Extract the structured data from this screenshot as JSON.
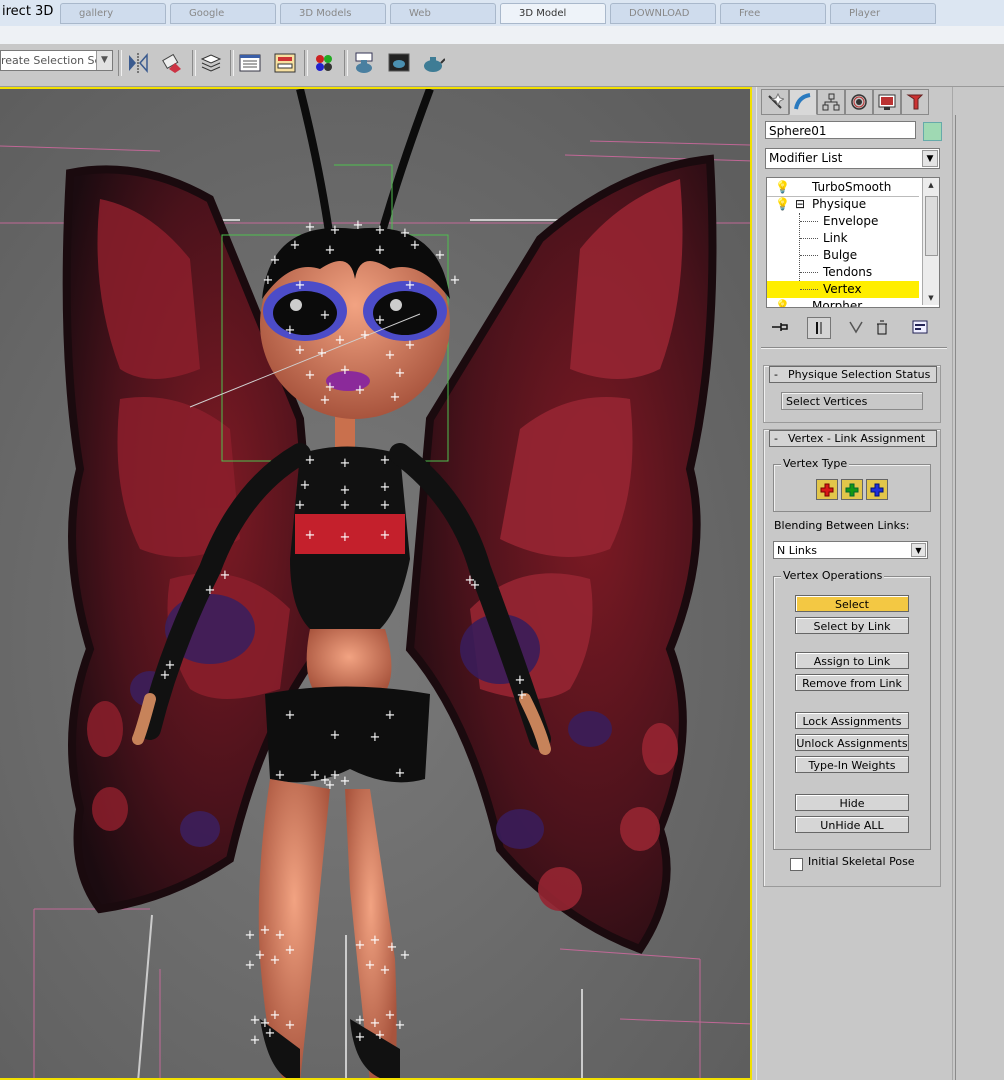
{
  "window": {
    "title": "irect 3D"
  },
  "tabs": [
    {
      "label": "gallery"
    },
    {
      "label": "Google"
    },
    {
      "label": "3D Models"
    },
    {
      "label": "Web"
    },
    {
      "label": "3D Model",
      "active": true
    },
    {
      "label": "DOWNLOAD"
    },
    {
      "label": "Free"
    },
    {
      "label": "Player"
    }
  ],
  "toolbar": {
    "selection_set": {
      "value": "reate Selection Set"
    },
    "icons": [
      "mirror-icon",
      "align-icon",
      "layer-manager-icon",
      "track-view-icon",
      "schematic-view-icon",
      "material-editor-icon",
      "render-setup-icon",
      "rendered-frame-icon",
      "quick-render-icon"
    ]
  },
  "command_panel": {
    "tabs": [
      "create-tab-icon",
      "modify-tab-icon",
      "hierarchy-tab-icon",
      "motion-tab-icon",
      "display-tab-icon",
      "utilities-tab-icon"
    ],
    "object_name": "Sphere01",
    "object_color": "#9fd9b3",
    "modifier_list": "Modifier List",
    "stack": [
      {
        "label": "TurboSmooth",
        "level": 0,
        "bulb": true
      },
      {
        "label": "Physique",
        "level": 0,
        "bulb": true,
        "expand": "⊟"
      },
      {
        "label": "Envelope",
        "level": 1
      },
      {
        "label": "Link",
        "level": 1
      },
      {
        "label": "Bulge",
        "level": 1
      },
      {
        "label": "Tendons",
        "level": 1
      },
      {
        "label": "Vertex",
        "level": 1,
        "selected": true
      },
      {
        "label": "Morpher",
        "level": 0,
        "bulb": true
      }
    ],
    "stack_tools": [
      "pin-stack-icon",
      "show-end-result-icon",
      "make-unique-icon",
      "remove-modifier-icon",
      "configure-modifier-sets-icon"
    ],
    "physique_status": {
      "title": "Physique Selection Status",
      "status": "Select Vertices"
    },
    "vertex_link": {
      "title": "Vertex - Link Assignment",
      "vertex_type_label": "Vertex Type",
      "vertex_type_colors": [
        "#d81818",
        "#139813",
        "#1e2fd8"
      ],
      "blending_label": "Blending Between Links:",
      "blending_value": "N Links",
      "operations_label": "Vertex Operations",
      "buttons": [
        {
          "label": "Select",
          "active": true
        },
        {
          "label": "Select by Link"
        },
        {
          "label": "Assign to Link"
        },
        {
          "label": "Remove from Link"
        },
        {
          "label": "Lock Assignments"
        },
        {
          "label": "Unlock Assignments"
        },
        {
          "label": "Type-In Weights"
        },
        {
          "label": "Hide"
        },
        {
          "label": "UnHide ALL"
        }
      ],
      "initial_pose_label": "Initial Skeletal Pose",
      "initial_pose_checked": false
    }
  },
  "viewport": {
    "border_color": "#f2e000"
  }
}
